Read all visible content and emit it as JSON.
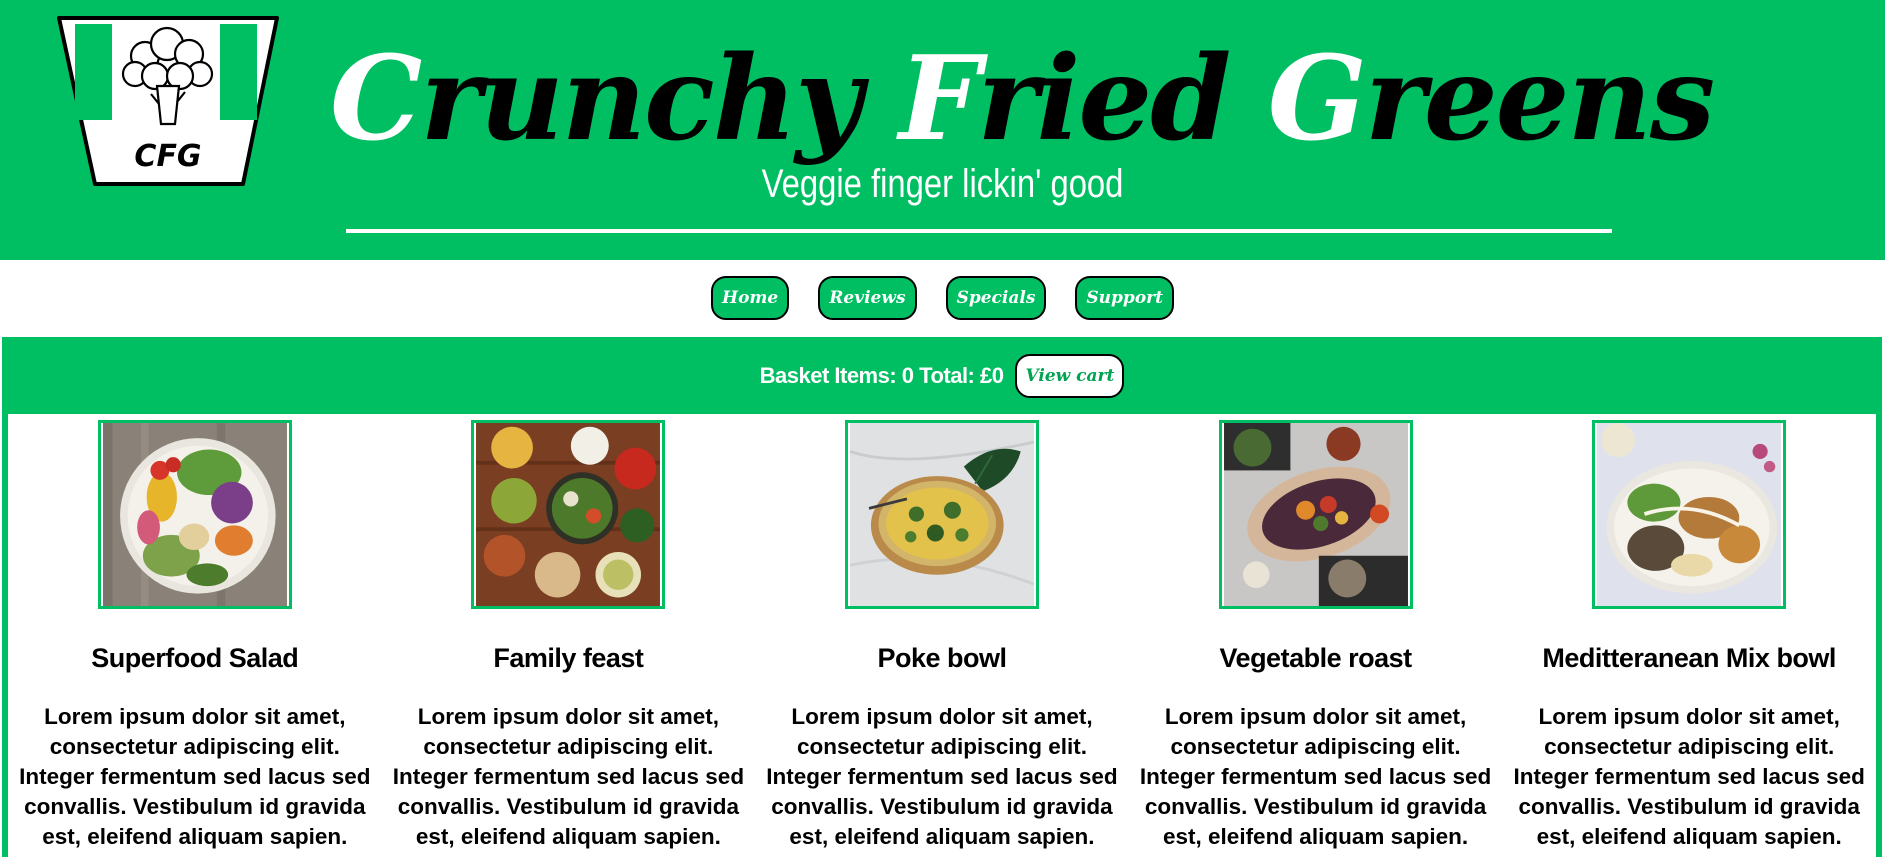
{
  "header": {
    "logo_text": "CFG",
    "title_parts": [
      {
        "text": "C",
        "white": true
      },
      {
        "text": "runchy ",
        "white": false
      },
      {
        "text": "F",
        "white": true
      },
      {
        "text": "ried ",
        "white": false
      },
      {
        "text": "G",
        "white": true
      },
      {
        "text": "reens",
        "white": false
      }
    ],
    "tagline": "Veggie finger lickin' good"
  },
  "nav": {
    "items": [
      {
        "label": "Home"
      },
      {
        "label": "Reviews"
      },
      {
        "label": "Specials"
      },
      {
        "label": "Support"
      }
    ]
  },
  "basket": {
    "summary": "Basket Items: 0 Total: £0",
    "view_cart_label": "View cart"
  },
  "products": [
    {
      "name": "Superfood Salad",
      "description": "Lorem ipsum dolor sit amet, consectetur adipiscing elit. Integer fermentum sed lacus sed convallis. Vestibulum id gravida est, eleifend aliquam sapien.",
      "image": "salad-bowl"
    },
    {
      "name": "Family feast",
      "description": "Lorem ipsum dolor sit amet, consectetur adipiscing elit. Integer fermentum sed lacus sed convallis. Vestibulum id gravida est, eleifend aliquam sapien.",
      "image": "family-feast-spread"
    },
    {
      "name": "Poke bowl",
      "description": "Lorem ipsum dolor sit amet, consectetur adipiscing elit. Integer fermentum sed lacus sed convallis. Vestibulum id gravida est, eleifend aliquam sapien.",
      "image": "poke-bowl"
    },
    {
      "name": "Vegetable roast",
      "description": "Lorem ipsum dolor sit amet, consectetur adipiscing elit. Integer fermentum sed lacus sed convallis. Vestibulum id gravida est, eleifend aliquam sapien.",
      "image": "vegetable-roast-platter"
    },
    {
      "name": "Meditteranean Mix bowl",
      "description": "Lorem ipsum dolor sit amet, consectetur adipiscing elit. Integer fermentum sed lacus sed convallis. Vestibulum id gravida est, eleifend aliquam sapien.",
      "image": "mediterranean-bowl"
    }
  ],
  "colors": {
    "brand_green": "#00BF63",
    "white": "#FFFFFF",
    "black": "#000000"
  }
}
